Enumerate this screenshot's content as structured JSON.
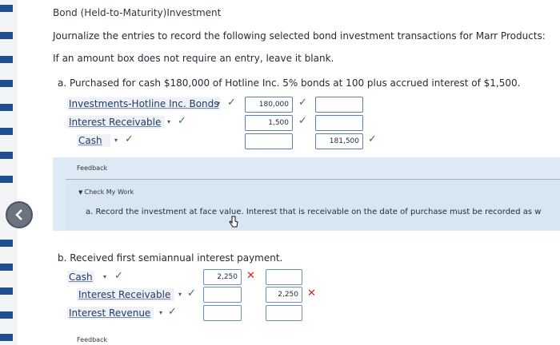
{
  "page": {
    "title": "Bond (Held-to-Maturity)Investment",
    "instructions": "Journalize the entries to record the following selected bond investment transactions for Marr Products:",
    "blank_note": "If an amount box does not require an entry, leave it blank."
  },
  "part_a": {
    "label": "a.  Purchased for cash $180,000 of Hotline Inc. 5% bonds at 100 plus accrued interest of $1,500.",
    "rows": [
      {
        "account": "Investments-Hotline Inc. Bonds",
        "debit": "180,000",
        "credit": ""
      },
      {
        "account": "Interest Receivable",
        "debit": "1,500",
        "credit": ""
      },
      {
        "account": "Cash",
        "debit": "",
        "credit": "181,500"
      }
    ],
    "feedback": {
      "label": "Feedback",
      "check_label": "Check My Work",
      "text": "a. Record the investment at face value. Interest that is receivable on the date of purchase must be recorded as w"
    }
  },
  "part_b": {
    "label": "b.  Received first semiannual interest payment.",
    "rows": [
      {
        "account": "Cash",
        "debit": "2,250",
        "credit": ""
      },
      {
        "account": "Interest Receivable",
        "debit": "",
        "credit": "2,250"
      },
      {
        "account": "Interest Revenue",
        "debit": "",
        "credit": ""
      }
    ],
    "feedback_label": "Feedback"
  },
  "marks": {
    "check": "✓",
    "cross": "✕",
    "caret": "▾"
  },
  "colors": {
    "correct": "#2e7d32",
    "incorrect": "#c62828",
    "accent": "#1f4f8f"
  }
}
